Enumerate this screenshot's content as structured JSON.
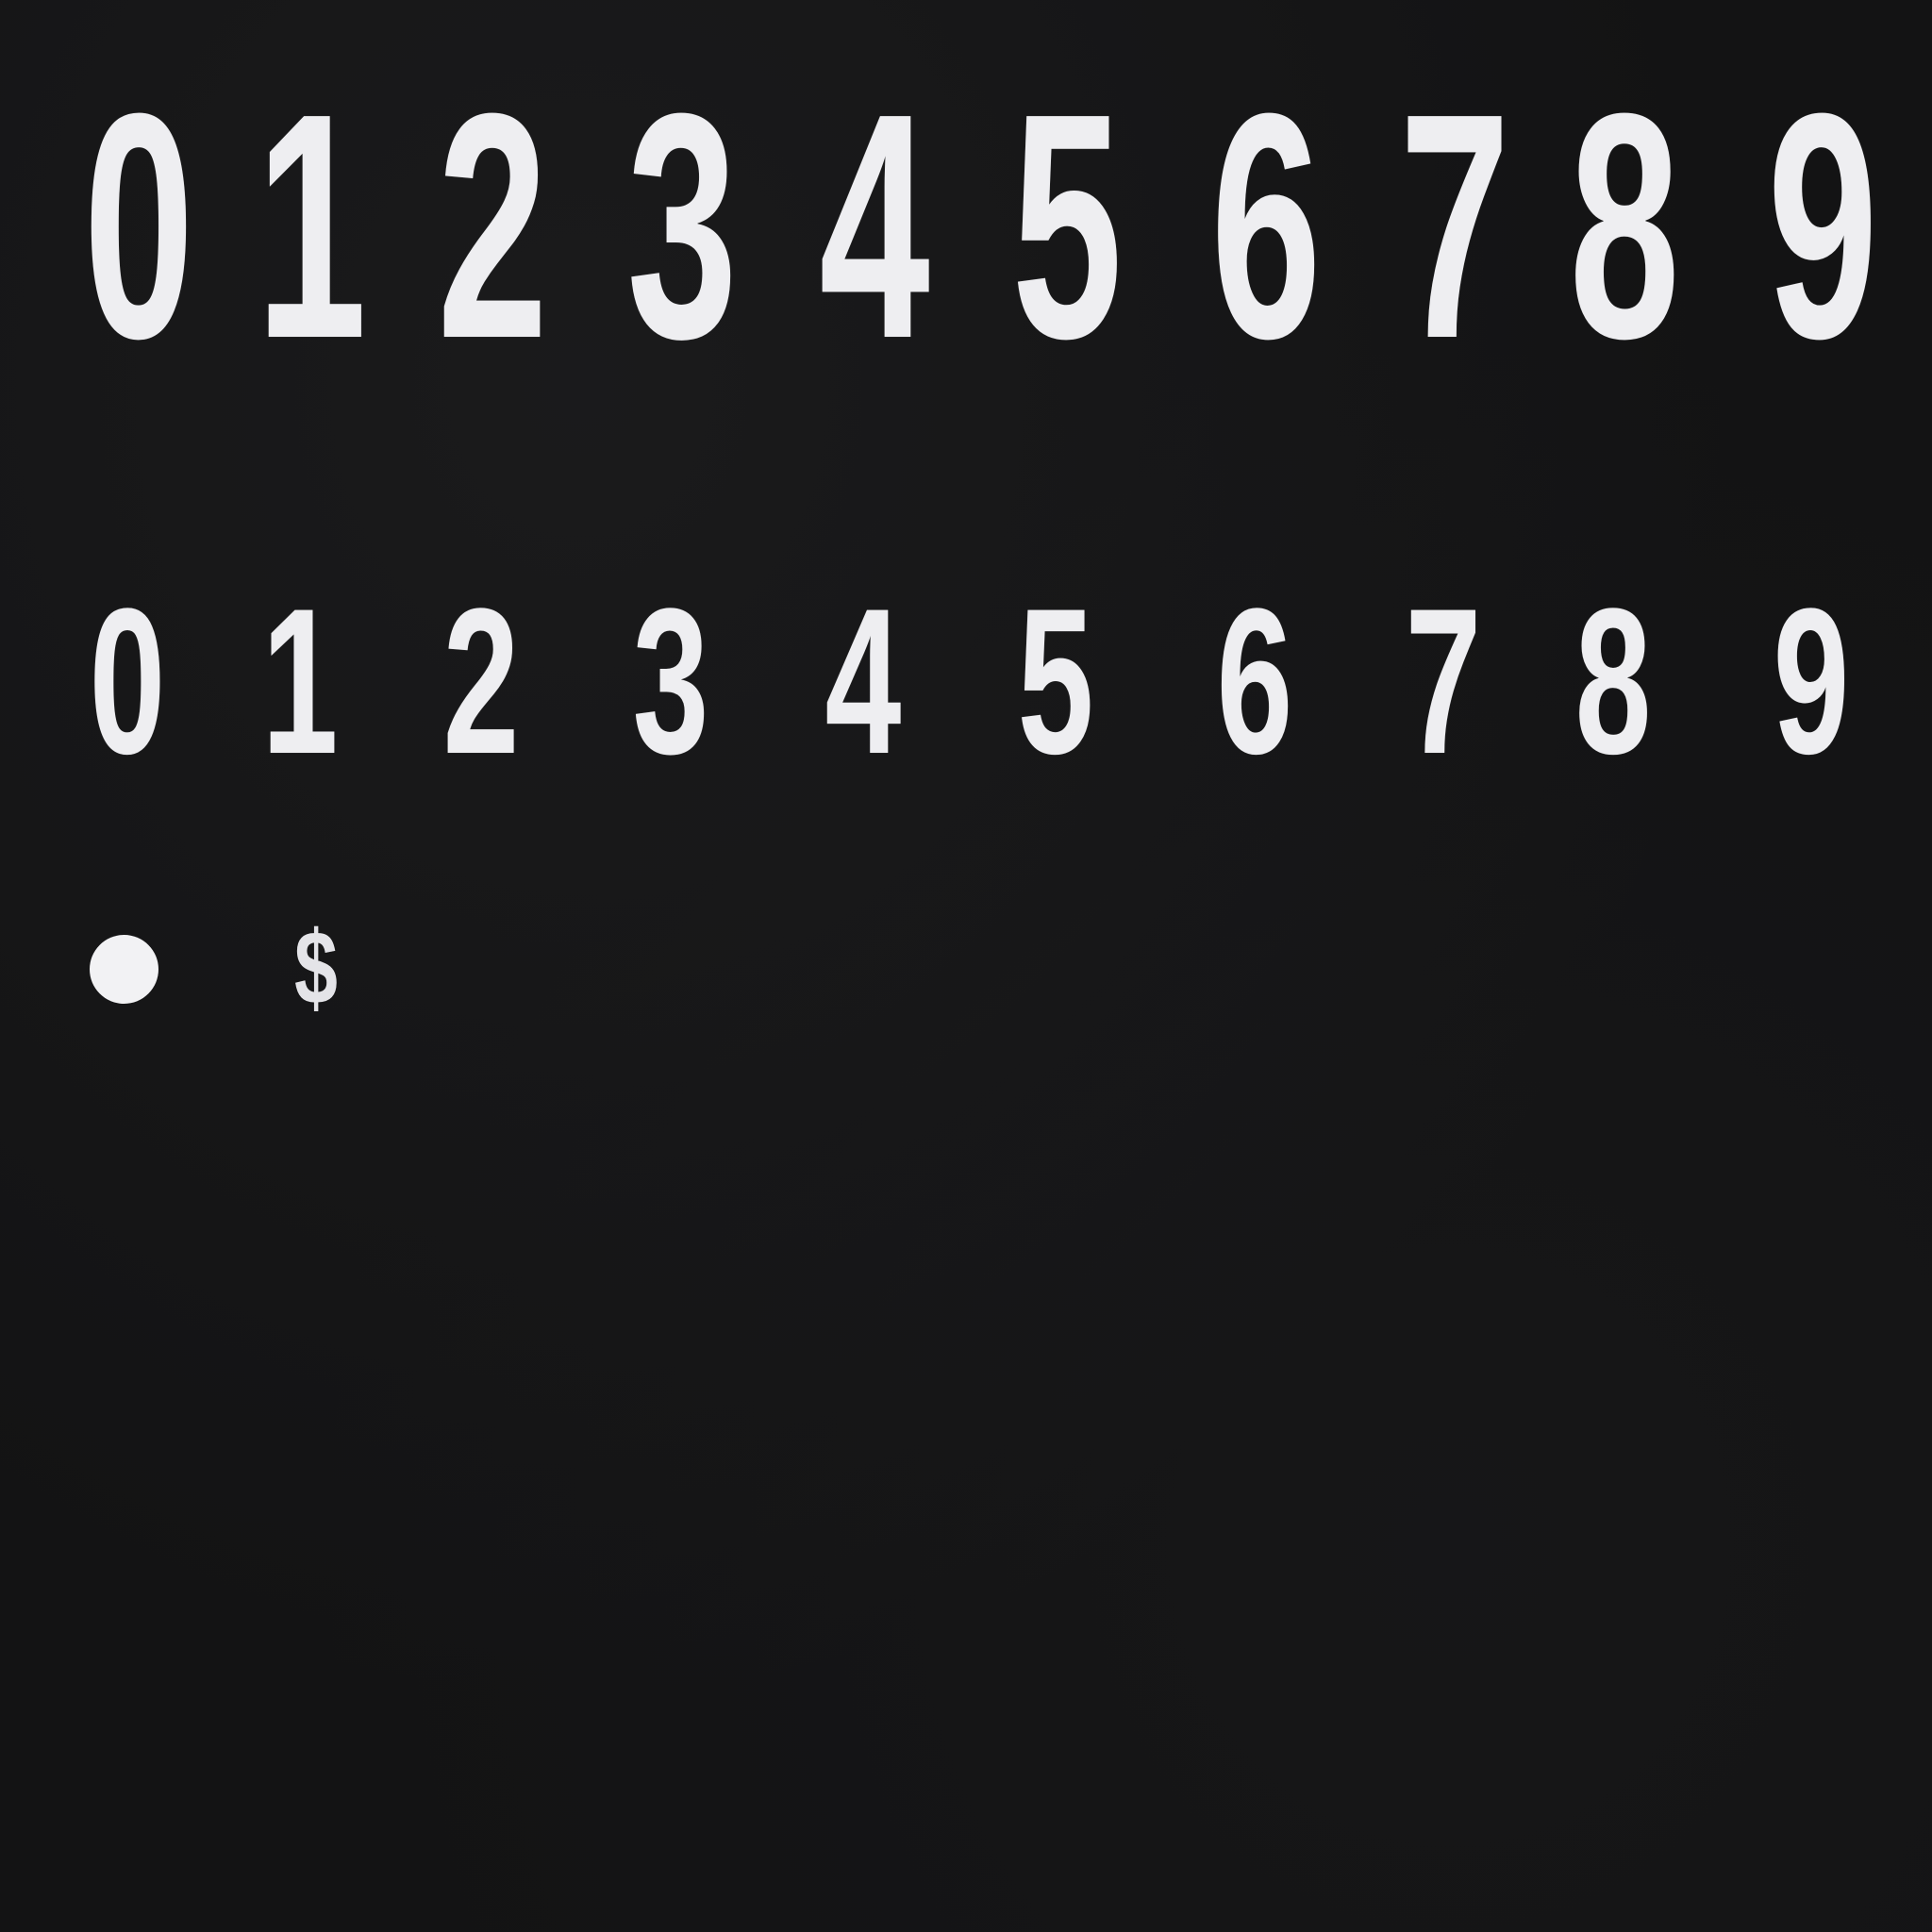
{
  "sprite_sheet": {
    "background_color": "#131314",
    "glyph_color": "#eeeef1",
    "large_digits": [
      "0",
      "1",
      "2",
      "3",
      "4",
      "5",
      "6",
      "7",
      "8",
      "9"
    ],
    "small_digits": [
      "0",
      "1",
      "2",
      "3",
      "4",
      "5",
      "6",
      "7",
      "8",
      "9"
    ],
    "symbols": {
      "dot_icon": "dot-icon",
      "currency": "$"
    }
  }
}
